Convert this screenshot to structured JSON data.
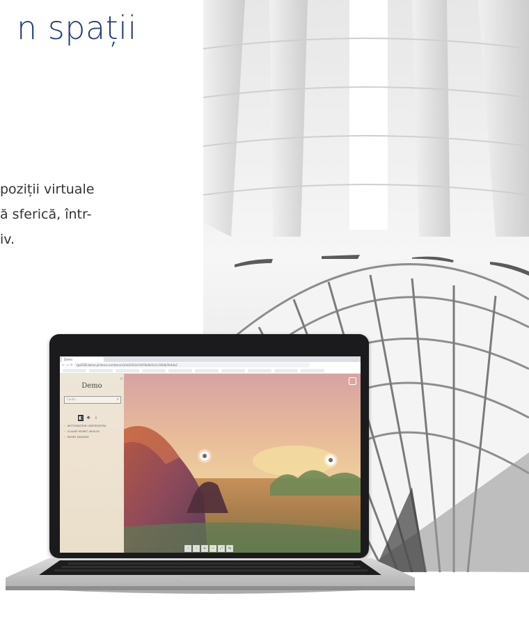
{
  "headline": "n spații",
  "body_lines": [
    "poziții  virtuale",
    "ă sferică, într-",
    "iv."
  ],
  "laptop_app": {
    "browser_tab": "Demo",
    "address": "tpolt3D.demo.pinhora.com/tour/v2/id/2022d-0d78a9c0c2c1044b7b4da2",
    "sidebar_title": "Demo",
    "search_placeholder": "Caută...",
    "menu": [
      "WITTGENSTEIN LIEBTRESSTRA",
      "CLAUDE MONET: MEULES",
      "MUSÉE MAGNUM"
    ],
    "controls": [
      "‹",
      "›",
      "+",
      "−",
      "⤢",
      "⇆"
    ]
  }
}
